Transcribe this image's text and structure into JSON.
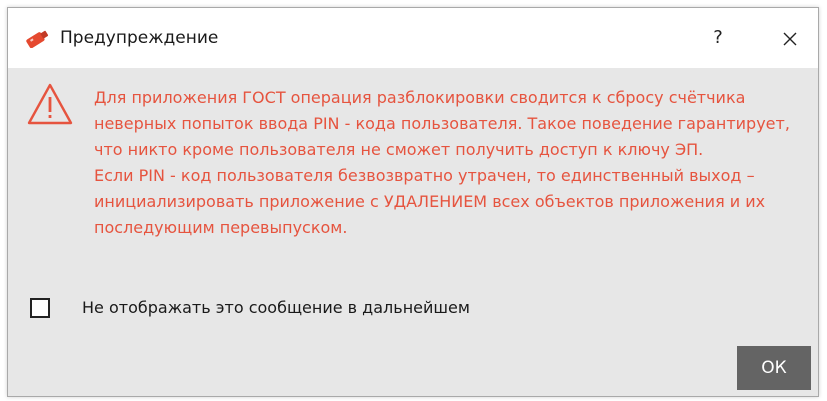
{
  "window": {
    "title": "Предупреждение",
    "help_label": "?",
    "close_icon": "close-icon",
    "app_icon": "token-key-icon"
  },
  "message": {
    "icon": "warning-triangle-icon",
    "paragraph_1": "Для приложения ГОСТ операция разблокировки сводится к сбросу счётчика неверных попыток ввода PIN - кода пользователя. Такое поведение гарантирует, что никто кроме пользователя не сможет получить доступ к ключу ЭП.",
    "paragraph_2": "Если PIN - код пользователя безвозвратно утрачен, то единственный выход – инициализировать приложение с УДАЛЕНИЕМ всех объектов приложения и их последующим перевыпуском.",
    "color": "#e6543f"
  },
  "options": {
    "dont_show_label": "Не отображать это сообщение в дальнейшем",
    "dont_show_checked": false
  },
  "buttons": {
    "ok_label": "ОК"
  },
  "colors": {
    "dialog_bg": "#e7e7e7",
    "titlebar_bg": "#ffffff",
    "ok_button_bg": "#646464",
    "warning": "#e6543f"
  }
}
